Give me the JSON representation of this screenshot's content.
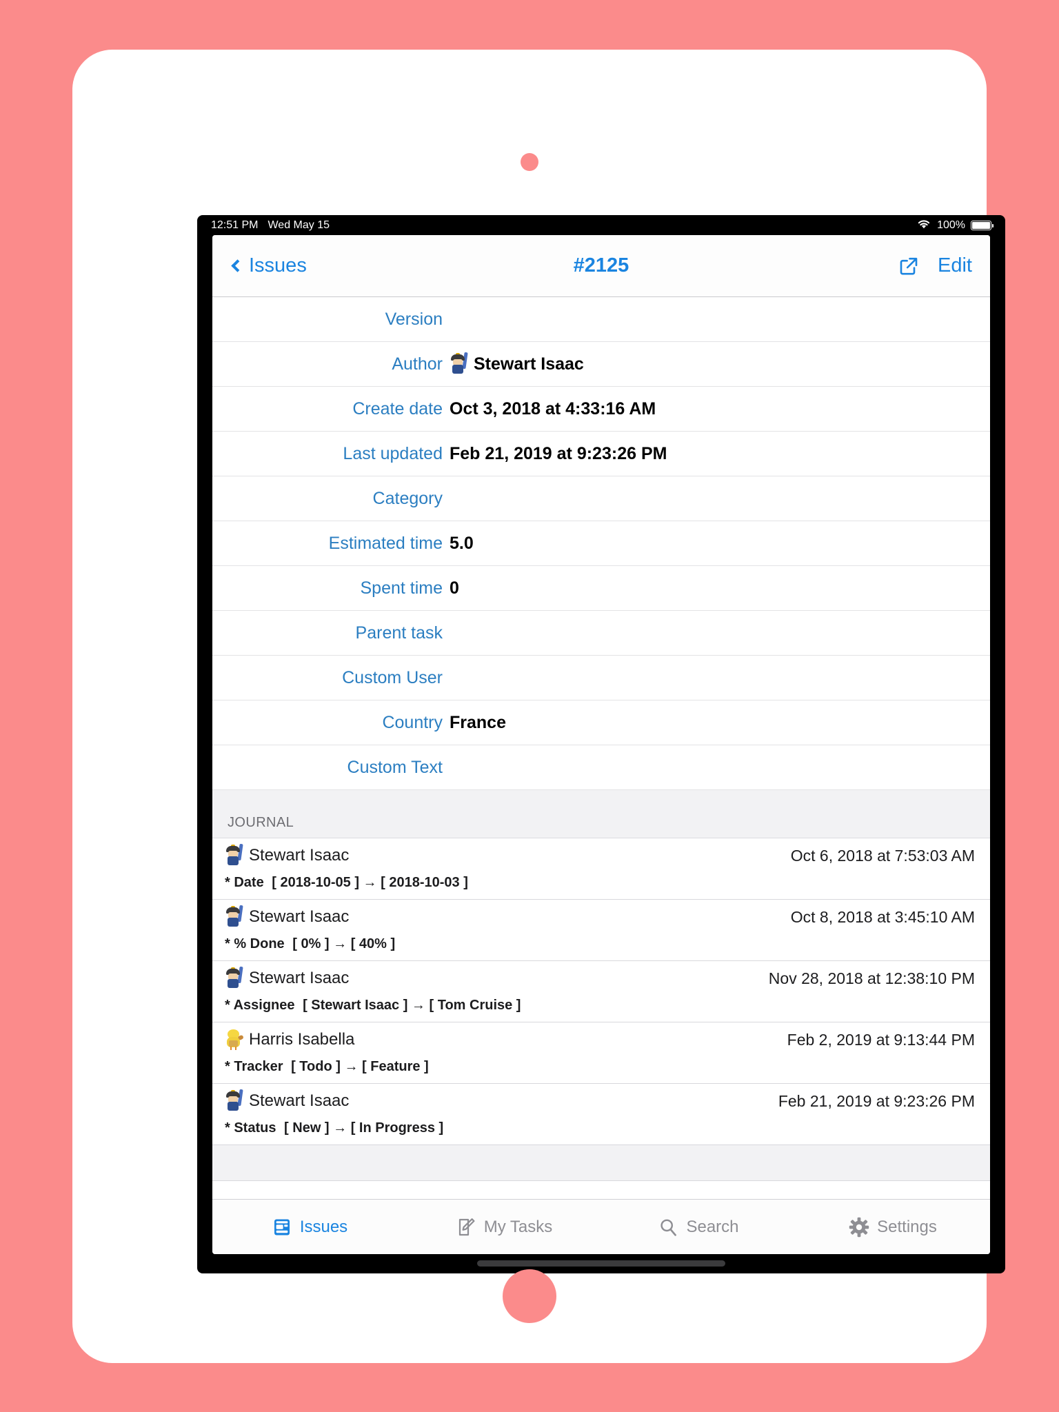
{
  "status_bar": {
    "time": "12:51 PM",
    "date": "Wed May 15",
    "wifi_icon": "wifi-icon",
    "battery_percent": "100%",
    "battery_icon": "battery-icon"
  },
  "nav_bar": {
    "back_label": "Issues",
    "back_icon": "chevron-left-icon",
    "title": "#2125",
    "share_icon": "share-external-link-icon",
    "edit_label": "Edit",
    "accent_color": "#1a84e0"
  },
  "details": {
    "rows": [
      {
        "label": "Version",
        "value": ""
      },
      {
        "label": "Author",
        "value": "Stewart Isaac",
        "avatar": "samurai"
      },
      {
        "label": "Create date",
        "value": "Oct 3, 2018 at 4:33:16 AM"
      },
      {
        "label": "Last updated",
        "value": "Feb 21, 2019 at 9:23:26 PM"
      },
      {
        "label": "Category",
        "value": ""
      },
      {
        "label": "Estimated time",
        "value": "5.0"
      },
      {
        "label": "Spent time",
        "value": "0"
      },
      {
        "label": "Parent task",
        "value": ""
      },
      {
        "label": "Custom User",
        "value": ""
      },
      {
        "label": "Country",
        "value": "France"
      },
      {
        "label": "Custom Text",
        "value": ""
      }
    ]
  },
  "journal": {
    "header": "JOURNAL",
    "entries": [
      {
        "user": "Stewart Isaac",
        "avatar": "samurai",
        "date": "Oct 6, 2018 at 7:53:03 AM",
        "field": "* Date",
        "change": "[ 2018-10-05 ] → [ 2018-10-03 ]"
      },
      {
        "user": "Stewart Isaac",
        "avatar": "samurai",
        "date": "Oct 8, 2018 at 3:45:10 AM",
        "field": "* % Done",
        "change": "[ 0% ] → [ 40% ]"
      },
      {
        "user": "Stewart Isaac",
        "avatar": "samurai",
        "date": "Nov 28, 2018 at 12:38:10 PM",
        "field": "* Assignee",
        "change": "[ Stewart Isaac ] → [ Tom Cruise ]"
      },
      {
        "user": "Harris Isabella",
        "avatar": "chick",
        "date": "Feb 2, 2019 at 9:13:44 PM",
        "field": "* Tracker",
        "change": "[ Todo ] → [ Feature ]"
      },
      {
        "user": "Stewart Isaac",
        "avatar": "samurai",
        "date": "Feb 21, 2019 at 9:23:26 PM",
        "field": "* Status",
        "change": "[ New ] → [ In Progress ]"
      }
    ]
  },
  "tab_bar": {
    "items": [
      {
        "label": "Issues",
        "icon": "issues-card-icon",
        "active": true
      },
      {
        "label": "My Tasks",
        "icon": "pencil-note-icon",
        "active": false
      },
      {
        "label": "Search",
        "icon": "magnifier-icon",
        "active": false
      },
      {
        "label": "Settings",
        "icon": "gear-icon",
        "active": false
      }
    ],
    "active_color": "#1a84e0",
    "inactive_color": "#8e8e93"
  },
  "device": {
    "background_color": "#fb8b8b",
    "body_color": "#ffffff"
  }
}
